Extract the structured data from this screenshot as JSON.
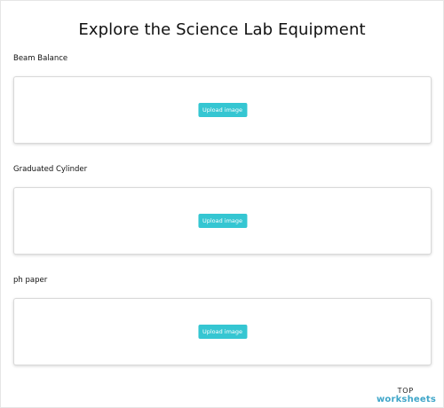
{
  "page": {
    "title": "Explore the Science Lab Equipment"
  },
  "sections": [
    {
      "label": "Beam Balance",
      "upload_label": "Upload image"
    },
    {
      "label": "Graduated Cylinder",
      "upload_label": "Upload image"
    },
    {
      "label": "ph paper",
      "upload_label": "Upload image"
    }
  ],
  "footer": {
    "logo_top": "TOP",
    "logo_bottom": "worksheets"
  },
  "colors": {
    "upload_button": "#35c6d2",
    "logo_accent": "#3fa6c9"
  }
}
